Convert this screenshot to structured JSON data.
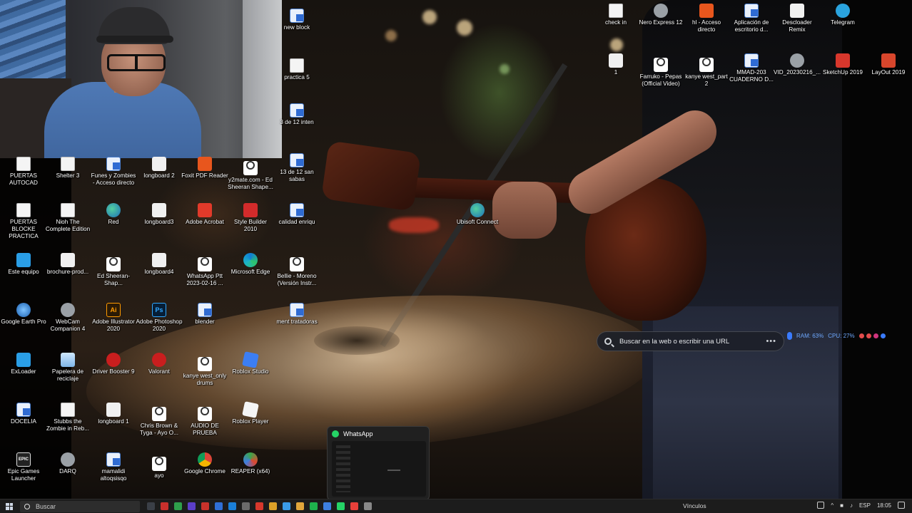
{
  "desktop_icons": [
    {
      "label": "new block",
      "icon": "document-blue-icon"
    },
    {
      "label": "practica 5",
      "icon": "document-icon"
    },
    {
      "label": "3 de 12 inten",
      "icon": "document-blue-icon"
    },
    {
      "label": "13 de 12 san sabas",
      "icon": "document-blue-icon"
    },
    {
      "label": "calidad enriqu",
      "icon": "document-blue-icon"
    },
    {
      "label": "Bellie - Moreno (Versión Instr...",
      "icon": "media-file-icon"
    },
    {
      "label": "ment tratadoras",
      "icon": "document-blue-icon"
    },
    {
      "label": "Roblox Studio",
      "icon": "roblox-studio-icon"
    },
    {
      "label": "Roblox Player",
      "icon": "roblox-player-icon"
    },
    {
      "label": "REAPER (x64)",
      "icon": "reaper-icon"
    },
    {
      "label": "PUERTAS AUTOCAD",
      "icon": "document-icon"
    },
    {
      "label": "PUERTAS BLOCKE PRACTICA",
      "icon": "document-icon"
    },
    {
      "label": "Este equipo",
      "icon": "this-pc-icon"
    },
    {
      "label": "Google Earth Pro",
      "icon": "google-earth-icon"
    },
    {
      "label": "ExLoader",
      "icon": "exloader-icon"
    },
    {
      "label": "DOCELIA",
      "icon": "document-blue-icon"
    },
    {
      "label": "Epic Games Launcher",
      "icon": "epic-games-icon"
    },
    {
      "label": "Shelter 3",
      "icon": "document-icon"
    },
    {
      "label": "Nioh The Complete Edition",
      "icon": "document-icon"
    },
    {
      "label": "brochure-prod...",
      "icon": "image-file-icon"
    },
    {
      "label": "WebCam Companion 4",
      "icon": "webcam-icon"
    },
    {
      "label": "Papelera de reciclaje",
      "icon": "recycle-bin-icon"
    },
    {
      "label": "Stubbs the Zombie in Reb...",
      "icon": "document-icon"
    },
    {
      "label": "DARQ",
      "icon": "darq-icon"
    },
    {
      "label": "Funes y Zombies - Acceso directo",
      "icon": "shortcut-icon"
    },
    {
      "label": "Red",
      "icon": "network-globe-icon"
    },
    {
      "label": "Ed Sheeran-Shap...",
      "icon": "media-file-icon"
    },
    {
      "label": "Adobe Illustrator 2020",
      "icon": "illustrator-icon"
    },
    {
      "label": "Driver Booster 9",
      "icon": "driver-booster-icon"
    },
    {
      "label": "longboard 1",
      "icon": "white-file-icon"
    },
    {
      "label": "mamalidi altoqsisqo",
      "icon": "document-blue-icon"
    },
    {
      "label": "longboard 2",
      "icon": "white-file-icon"
    },
    {
      "label": "longboard3",
      "icon": "white-file-icon"
    },
    {
      "label": "longboard4",
      "icon": "white-file-icon"
    },
    {
      "label": "Adobe Photoshop 2020",
      "icon": "photoshop-icon"
    },
    {
      "label": "Valorant",
      "icon": "booster-red-icon"
    },
    {
      "label": "Chris Brown & Tyga - Ayo O...",
      "icon": "media-file-icon"
    },
    {
      "label": "ayo",
      "icon": "media-file-icon"
    },
    {
      "label": "Foxit PDF Reader",
      "icon": "foxit-pdf-icon"
    },
    {
      "label": "Adobe Acrobat",
      "icon": "acrobat-icon"
    },
    {
      "label": "WhatsApp Ptt 2023-02-16 ...",
      "icon": "media-file-icon"
    },
    {
      "label": "blender",
      "icon": "document-blue-icon"
    },
    {
      "label": "kanye west_only drums",
      "icon": "media-file-icon"
    },
    {
      "label": "AUDIO DE PRUEBA",
      "icon": "media-file-icon"
    },
    {
      "label": "Google Chrome",
      "icon": "chrome-icon"
    },
    {
      "label": "y2mate.com - Ed Sheeran  Shape...",
      "icon": "media-file-icon"
    },
    {
      "label": "Style Builder 2010",
      "icon": "style-builder-icon"
    },
    {
      "label": "Microsoft Edge",
      "icon": "edge-icon"
    },
    {
      "label": "Ubisoft Connect",
      "icon": "ubisoft-icon"
    },
    {
      "label": "check in",
      "icon": "document-icon"
    },
    {
      "label": "1",
      "icon": "image-file-icon"
    },
    {
      "label": "Nero Express 12",
      "icon": "nero-icon"
    },
    {
      "label": "Farruko - Pepas (Official Video)",
      "icon": "media-file-icon"
    },
    {
      "label": "hl - Acceso directo",
      "icon": "half-life-icon"
    },
    {
      "label": "kanye west_part 2",
      "icon": "media-file-icon"
    },
    {
      "label": "Aplicación de escritorio d...",
      "icon": "document-blue-icon"
    },
    {
      "label": "MMAD-203 CUADERNO D...",
      "icon": "document-blue-icon"
    },
    {
      "label": "Descloader Remix",
      "icon": "downloader-icon"
    },
    {
      "label": "VID_20230216_...",
      "icon": "video-file-icon"
    },
    {
      "label": "Telegram",
      "icon": "telegram-icon"
    },
    {
      "label": "SketchUp 2019",
      "icon": "sketchup-icon"
    },
    {
      "label": "LayOut 2019",
      "icon": "layout-icon"
    }
  ],
  "search_widget": {
    "placeholder": "Buscar en la web o escribir una URL",
    "more": "•••"
  },
  "perf_overlay": {
    "ram": "RAM: 63%",
    "cpu": "CPU: 27%"
  },
  "whatsapp_preview": {
    "title": "WhatsApp"
  },
  "taskbar": {
    "search_label": "Buscar",
    "links_label": "Vínculos",
    "language": "ESP",
    "time": "18:05",
    "pinned_colors": [
      "#3a3f47",
      "#c9302c",
      "#2e9f4b",
      "#5b3ec8",
      "#c8322b",
      "#2f6fd6",
      "#1a7fd8",
      "#6b6b6b",
      "#d7382c",
      "#dca128",
      "#3a9be8",
      "#e2a63b",
      "#1eb24d",
      "#3d7fe0",
      "#25d366",
      "#e8403a",
      "#888888"
    ]
  }
}
